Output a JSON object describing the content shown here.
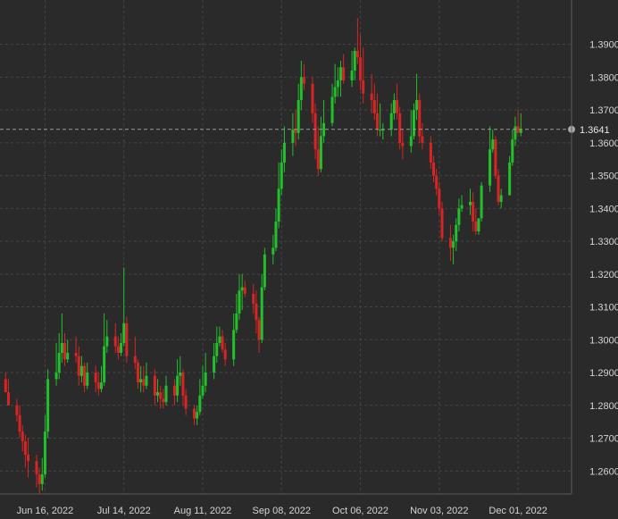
{
  "colors": {
    "background": "#2a2a2a",
    "grid": "#444444",
    "up": "#22c02c",
    "down": "#d82424",
    "text": "#d4d4d4",
    "price_line": "#9a9a9a",
    "price_dot": "#a8a8a8"
  },
  "chart_data": {
    "type": "candlestick",
    "grid": true,
    "y_axis_position": "right",
    "ylim": [
      1.253,
      1.4035
    ],
    "y_ticks": [
      "1.2600",
      "1.2700",
      "1.2800",
      "1.2900",
      "1.3000",
      "1.3100",
      "1.3200",
      "1.3300",
      "1.3400",
      "1.3500",
      "1.3600",
      "1.3700",
      "1.3800",
      "1.3900"
    ],
    "x_ticks": [
      "Jun 16, 2022",
      "Jul 14, 2022",
      "Aug 11, 2022",
      "Sep 08, 2022",
      "Oct 06, 2022",
      "Nov 03, 2022",
      "Dec 01, 2022"
    ],
    "x_tick_dates": [
      "2022-06-16",
      "2022-07-14",
      "2022-08-11",
      "2022-09-08",
      "2022-10-06",
      "2022-11-03",
      "2022-12-01"
    ],
    "last_price": {
      "value": 1.3641,
      "label": "1.3641"
    },
    "dates": [
      "2022-06-02",
      "2022-06-03",
      "2022-06-06",
      "2022-06-07",
      "2022-06-08",
      "2022-06-09",
      "2022-06-10",
      "2022-06-13",
      "2022-06-14",
      "2022-06-15",
      "2022-06-16",
      "2022-06-17",
      "2022-06-20",
      "2022-06-21",
      "2022-06-22",
      "2022-06-23",
      "2022-06-24",
      "2022-06-27",
      "2022-06-28",
      "2022-06-29",
      "2022-06-30",
      "2022-07-01",
      "2022-07-04",
      "2022-07-05",
      "2022-07-06",
      "2022-07-07",
      "2022-07-08",
      "2022-07-11",
      "2022-07-12",
      "2022-07-13",
      "2022-07-14",
      "2022-07-15",
      "2022-07-18",
      "2022-07-19",
      "2022-07-20",
      "2022-07-21",
      "2022-07-22",
      "2022-07-25",
      "2022-07-26",
      "2022-07-27",
      "2022-07-28",
      "2022-07-29",
      "2022-08-01",
      "2022-08-02",
      "2022-08-03",
      "2022-08-04",
      "2022-08-05",
      "2022-08-08",
      "2022-08-09",
      "2022-08-10",
      "2022-08-11",
      "2022-08-12",
      "2022-08-15",
      "2022-08-16",
      "2022-08-17",
      "2022-08-18",
      "2022-08-19",
      "2022-08-22",
      "2022-08-23",
      "2022-08-24",
      "2022-08-25",
      "2022-08-26",
      "2022-08-29",
      "2022-08-30",
      "2022-08-31",
      "2022-09-01",
      "2022-09-02",
      "2022-09-05",
      "2022-09-06",
      "2022-09-07",
      "2022-09-08",
      "2022-09-09",
      "2022-09-12",
      "2022-09-13",
      "2022-09-14",
      "2022-09-15",
      "2022-09-16",
      "2022-09-19",
      "2022-09-20",
      "2022-09-21",
      "2022-09-22",
      "2022-09-23",
      "2022-09-26",
      "2022-09-27",
      "2022-09-28",
      "2022-09-29",
      "2022-09-30",
      "2022-10-03",
      "2022-10-04",
      "2022-10-05",
      "2022-10-06",
      "2022-10-07",
      "2022-10-10",
      "2022-10-11",
      "2022-10-12",
      "2022-10-13",
      "2022-10-14",
      "2022-10-17",
      "2022-10-18",
      "2022-10-19",
      "2022-10-20",
      "2022-10-21",
      "2022-10-24",
      "2022-10-25",
      "2022-10-26",
      "2022-10-27",
      "2022-10-28",
      "2022-10-31",
      "2022-11-01",
      "2022-11-02",
      "2022-11-03",
      "2022-11-04",
      "2022-11-07",
      "2022-11-08",
      "2022-11-09",
      "2022-11-10",
      "2022-11-11",
      "2022-11-14",
      "2022-11-15",
      "2022-11-16",
      "2022-11-17",
      "2022-11-18",
      "2022-11-21",
      "2022-11-22",
      "2022-11-23",
      "2022-11-24",
      "2022-11-25",
      "2022-11-28",
      "2022-11-29",
      "2022-11-30",
      "2022-12-01",
      "2022-12-02",
      "2022-12-05",
      "2022-12-06"
    ],
    "open": [
      1.288,
      1.284,
      1.28,
      1.277,
      1.272,
      1.269,
      1.265,
      1.263,
      1.259,
      1.256,
      1.259,
      1.272,
      1.288,
      1.29,
      1.296,
      1.299,
      1.294,
      1.296,
      1.295,
      1.289,
      1.292,
      1.286,
      1.29,
      1.287,
      1.285,
      1.287,
      1.298,
      1.301,
      1.298,
      1.296,
      1.299,
      1.305,
      1.295,
      1.293,
      1.287,
      1.288,
      1.286,
      1.289,
      1.283,
      1.284,
      1.282,
      1.281,
      1.286,
      1.283,
      1.289,
      1.29,
      1.283,
      1.279,
      1.276,
      1.278,
      1.283,
      1.286,
      1.29,
      1.295,
      1.299,
      1.301,
      1.297,
      1.294,
      1.303,
      1.308,
      1.315,
      1.316,
      1.314,
      1.311,
      1.306,
      1.3,
      1.316,
      1.326,
      1.328,
      1.336,
      1.346,
      1.354,
      1.36,
      1.364,
      1.363,
      1.373,
      1.38,
      1.378,
      1.369,
      1.358,
      1.352,
      1.362,
      1.366,
      1.374,
      1.377,
      1.379,
      1.383,
      1.379,
      1.382,
      1.388,
      1.386,
      1.379,
      1.375,
      1.373,
      1.369,
      1.364,
      1.364,
      1.364,
      1.369,
      1.373,
      1.369,
      1.36,
      1.359,
      1.362,
      1.37,
      1.373,
      1.362,
      1.36,
      1.354,
      1.35,
      1.346,
      1.34,
      1.331,
      1.328,
      1.33,
      1.335,
      1.34,
      1.341,
      1.342,
      1.336,
      1.333,
      1.337,
      1.347,
      1.358,
      1.361,
      1.35,
      1.342,
      1.344,
      1.354,
      1.361,
      1.365,
      1.363
    ],
    "high": [
      1.29,
      1.288,
      1.282,
      1.28,
      1.274,
      1.271,
      1.27,
      1.265,
      1.261,
      1.264,
      1.277,
      1.291,
      1.299,
      1.302,
      1.308,
      1.302,
      1.3,
      1.301,
      1.298,
      1.295,
      1.293,
      1.293,
      1.292,
      1.29,
      1.292,
      1.308,
      1.306,
      1.305,
      1.301,
      1.302,
      1.322,
      1.307,
      1.301,
      1.294,
      1.292,
      1.292,
      1.293,
      1.291,
      1.288,
      1.286,
      1.285,
      1.289,
      1.288,
      1.294,
      1.295,
      1.291,
      1.285,
      1.28,
      1.28,
      1.288,
      1.292,
      1.296,
      1.299,
      1.304,
      1.304,
      1.303,
      1.299,
      1.308,
      1.314,
      1.32,
      1.32,
      1.318,
      1.317,
      1.315,
      1.307,
      1.32,
      1.328,
      1.332,
      1.34,
      1.354,
      1.358,
      1.365,
      1.369,
      1.37,
      1.378,
      1.385,
      1.384,
      1.38,
      1.372,
      1.365,
      1.368,
      1.373,
      1.378,
      1.384,
      1.383,
      1.385,
      1.387,
      1.388,
      1.389,
      1.398,
      1.393,
      1.389,
      1.381,
      1.378,
      1.375,
      1.372,
      1.366,
      1.372,
      1.375,
      1.378,
      1.371,
      1.364,
      1.37,
      1.372,
      1.381,
      1.375,
      1.366,
      1.362,
      1.356,
      1.352,
      1.348,
      1.342,
      1.335,
      1.332,
      1.337,
      1.343,
      1.344,
      1.346,
      1.345,
      1.34,
      1.337,
      1.348,
      1.365,
      1.364,
      1.362,
      1.352,
      1.346,
      1.356,
      1.364,
      1.368,
      1.37,
      1.369
    ],
    "low": [
      1.286,
      1.28,
      1.275,
      1.27,
      1.266,
      1.261,
      1.258,
      1.255,
      1.253,
      1.254,
      1.258,
      1.27,
      1.286,
      1.288,
      1.293,
      1.292,
      1.293,
      1.293,
      1.286,
      1.287,
      1.284,
      1.285,
      1.284,
      1.283,
      1.284,
      1.286,
      1.296,
      1.296,
      1.294,
      1.295,
      1.298,
      1.293,
      1.291,
      1.285,
      1.284,
      1.284,
      1.285,
      1.28,
      1.281,
      1.279,
      1.279,
      1.28,
      1.28,
      1.281,
      1.286,
      1.28,
      1.277,
      1.274,
      1.274,
      1.277,
      1.282,
      1.284,
      1.288,
      1.293,
      1.298,
      1.296,
      1.292,
      1.292,
      1.302,
      1.306,
      1.309,
      1.313,
      1.308,
      1.302,
      1.296,
      1.299,
      1.315,
      1.323,
      1.327,
      1.334,
      1.344,
      1.351,
      1.356,
      1.359,
      1.361,
      1.37,
      1.376,
      1.366,
      1.355,
      1.35,
      1.351,
      1.36,
      1.365,
      1.372,
      1.374,
      1.374,
      1.378,
      1.377,
      1.379,
      1.384,
      1.376,
      1.372,
      1.369,
      1.367,
      1.362,
      1.362,
      1.361,
      1.362,
      1.367,
      1.367,
      1.358,
      1.355,
      1.357,
      1.361,
      1.367,
      1.36,
      1.358,
      1.352,
      1.348,
      1.344,
      1.338,
      1.33,
      1.324,
      1.323,
      1.327,
      1.333,
      1.339,
      1.338,
      1.333,
      1.332,
      1.332,
      1.336,
      1.345,
      1.357,
      1.349,
      1.341,
      1.34,
      1.344,
      1.353,
      1.359,
      1.363,
      1.362
    ],
    "close": [
      1.284,
      1.28,
      1.277,
      1.272,
      1.269,
      1.265,
      1.263,
      1.259,
      1.256,
      1.259,
      1.272,
      1.288,
      1.29,
      1.296,
      1.299,
      1.294,
      1.296,
      1.295,
      1.289,
      1.292,
      1.286,
      1.29,
      1.287,
      1.285,
      1.287,
      1.298,
      1.301,
      1.298,
      1.296,
      1.299,
      1.305,
      1.295,
      1.293,
      1.287,
      1.288,
      1.286,
      1.289,
      1.283,
      1.284,
      1.282,
      1.281,
      1.286,
      1.283,
      1.289,
      1.29,
      1.283,
      1.279,
      1.276,
      1.278,
      1.283,
      1.286,
      1.29,
      1.295,
      1.299,
      1.301,
      1.297,
      1.294,
      1.303,
      1.308,
      1.315,
      1.316,
      1.314,
      1.311,
      1.306,
      1.3,
      1.316,
      1.326,
      1.328,
      1.336,
      1.346,
      1.354,
      1.36,
      1.364,
      1.363,
      1.373,
      1.38,
      1.378,
      1.369,
      1.358,
      1.352,
      1.362,
      1.366,
      1.374,
      1.377,
      1.379,
      1.383,
      1.379,
      1.382,
      1.388,
      1.386,
      1.379,
      1.375,
      1.373,
      1.369,
      1.364,
      1.364,
      1.364,
      1.369,
      1.373,
      1.369,
      1.36,
      1.359,
      1.362,
      1.37,
      1.373,
      1.362,
      1.36,
      1.354,
      1.35,
      1.346,
      1.34,
      1.331,
      1.328,
      1.33,
      1.335,
      1.34,
      1.341,
      1.342,
      1.336,
      1.333,
      1.337,
      1.347,
      1.358,
      1.361,
      1.35,
      1.342,
      1.344,
      1.354,
      1.361,
      1.365,
      1.363,
      1.3641
    ]
  }
}
